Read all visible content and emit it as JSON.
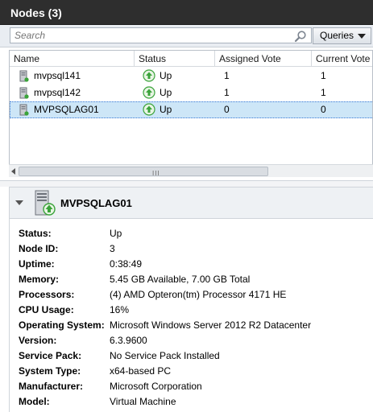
{
  "header": {
    "title": "Nodes (3)"
  },
  "search": {
    "placeholder": "Search",
    "queries_label": "Queries"
  },
  "grid": {
    "columns": [
      "Name",
      "Status",
      "Assigned Vote",
      "Current Vote"
    ],
    "rows": [
      {
        "name": "mvpsql141",
        "status": "Up",
        "assigned_vote": "1",
        "current_vote": "1",
        "selected": false
      },
      {
        "name": "mvpsql142",
        "status": "Up",
        "assigned_vote": "1",
        "current_vote": "1",
        "selected": false
      },
      {
        "name": "MVPSQLAG01",
        "status": "Up",
        "assigned_vote": "0",
        "current_vote": "0",
        "selected": true
      }
    ]
  },
  "scrollbar": {
    "grip": "III"
  },
  "detail": {
    "title": "MVPSQLAG01",
    "properties": [
      {
        "label": "Status:",
        "value": "Up"
      },
      {
        "label": "Node ID:",
        "value": "3"
      },
      {
        "label": "Uptime:",
        "value": "0:38:49"
      },
      {
        "label": "Memory:",
        "value": "5.45 GB Available, 7.00 GB Total"
      },
      {
        "label": "Processors:",
        "value": "(4) AMD Opteron(tm) Processor 4171 HE"
      },
      {
        "label": "CPU Usage:",
        "value": "16%"
      },
      {
        "label": "Operating System:",
        "value": "Microsoft Windows Server 2012 R2 Datacenter"
      },
      {
        "label": "Version:",
        "value": "6.3.9600"
      },
      {
        "label": "Service Pack:",
        "value": "No Service Pack Installed"
      },
      {
        "label": "System Type:",
        "value": "x64-based PC"
      },
      {
        "label": "Manufacturer:",
        "value": "Microsoft Corporation"
      },
      {
        "label": "Model:",
        "value": "Virtual Machine"
      }
    ]
  },
  "colors": {
    "titlebar": "#2e2e2e",
    "selection": "#cde6f7",
    "status_up": "#3aa33a"
  },
  "icons": {
    "search": "magnifier-icon",
    "node": "server-node-icon",
    "status_up": "up-arrow-icon",
    "collapse": "chevron-down-icon"
  }
}
